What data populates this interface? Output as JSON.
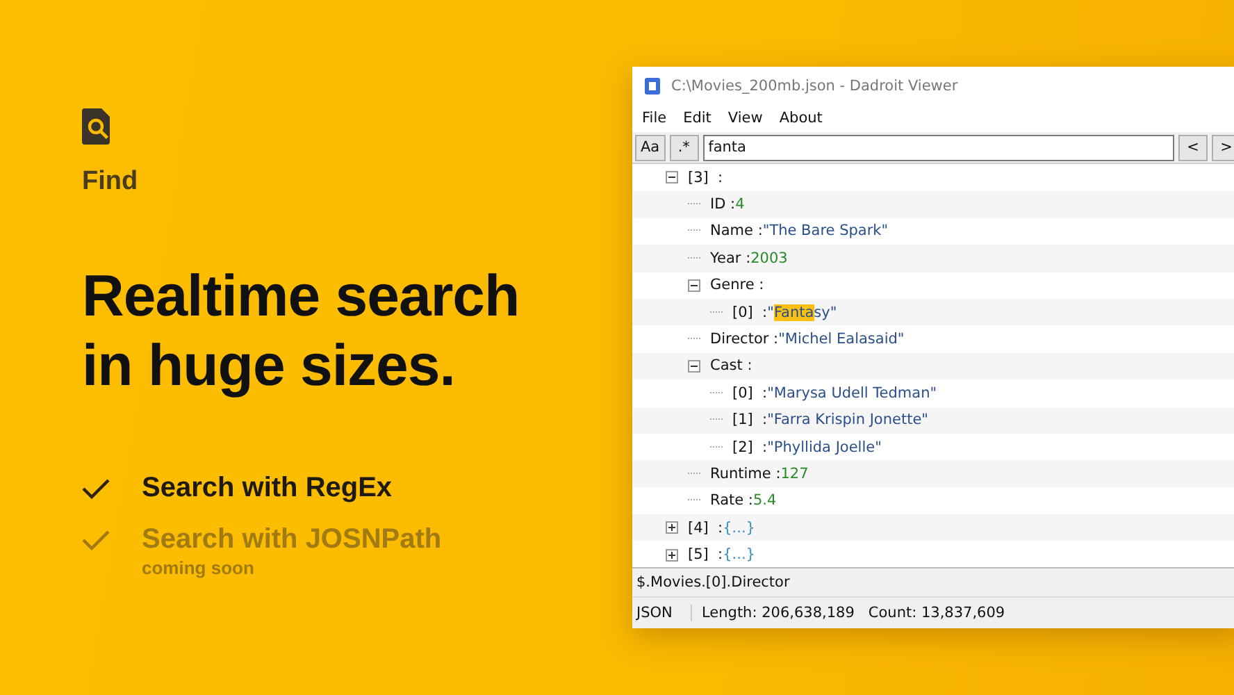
{
  "promo": {
    "section_label": "Find",
    "headline_lines": [
      "Realtime search",
      "in huge sizes."
    ],
    "features": [
      {
        "label": "Search with RegEx",
        "disabled": false
      },
      {
        "label": "Search with JOSNPath",
        "disabled": true,
        "note": "coming soon"
      }
    ]
  },
  "window": {
    "title": "C:\\Movies_200mb.json - Dadroit Viewer",
    "menu": [
      "File",
      "Edit",
      "View",
      "About"
    ],
    "toolbar": {
      "case_button": "Aa",
      "regex_button": ".*",
      "search_value": "fanta",
      "prev_button": "<",
      "next_button": ">"
    },
    "tree": [
      {
        "key": "[3]  :",
        "expanded": true,
        "children": [
          {
            "key": "ID :",
            "kind": "number",
            "value": [
              {
                "text": "4",
                "match": false
              }
            ]
          },
          {
            "key": "Name :",
            "kind": "string",
            "value": [
              {
                "text": "\"The Bare Spark\"",
                "match": false
              }
            ]
          },
          {
            "key": "Year :",
            "kind": "number",
            "value": [
              {
                "text": "2003",
                "match": false
              }
            ]
          },
          {
            "key": "Genre :",
            "expanded": true,
            "children": [
              {
                "key": "[0]  :",
                "kind": "string",
                "value": [
                  {
                    "text": "\"",
                    "match": false
                  },
                  {
                    "text": "Fanta",
                    "match": true
                  },
                  {
                    "text": "sy\"",
                    "match": false
                  }
                ]
              }
            ]
          },
          {
            "key": "Director :",
            "kind": "string",
            "value": [
              {
                "text": "\"Michel Ealasaid\"",
                "match": false
              }
            ]
          },
          {
            "key": "Cast :",
            "expanded": true,
            "children": [
              {
                "key": "[0]  :",
                "kind": "string",
                "value": [
                  {
                    "text": "\"Marysa Udell Tedman\"",
                    "match": false
                  }
                ]
              },
              {
                "key": "[1]  :",
                "kind": "string",
                "value": [
                  {
                    "text": "\"Farra Krispin Jonette\"",
                    "match": false
                  }
                ]
              },
              {
                "key": "[2]  :",
                "kind": "string",
                "value": [
                  {
                    "text": "\"Phyllida Joelle\"",
                    "match": false
                  }
                ]
              }
            ]
          },
          {
            "key": "Runtime :",
            "kind": "number",
            "value": [
              {
                "text": "127",
                "match": false
              }
            ]
          },
          {
            "key": "Rate :",
            "kind": "number",
            "value": [
              {
                "text": "5.4",
                "match": false
              }
            ]
          }
        ]
      },
      {
        "key": "[4]  :",
        "expanded": false,
        "kind": "collapsed",
        "value": [
          {
            "text": "{...}",
            "match": false
          }
        ]
      },
      {
        "key": "[5]  :",
        "expanded": false,
        "kind": "collapsed",
        "value": [
          {
            "text": "{...}",
            "match": false
          }
        ]
      }
    ],
    "path": "$.Movies.[0].Director",
    "status_bar": [
      "JSON",
      "Length: 206,638,189",
      "Count: 13,837,609"
    ]
  }
}
